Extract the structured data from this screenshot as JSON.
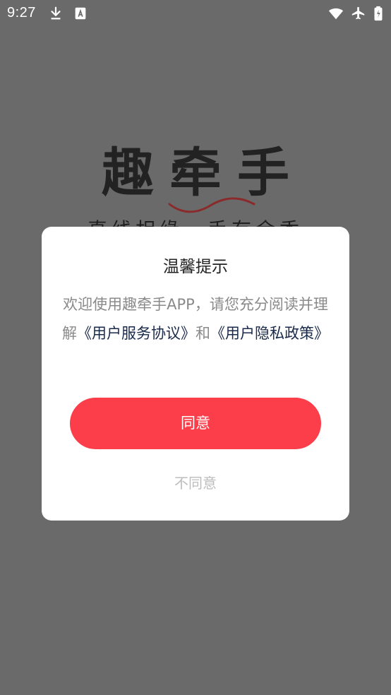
{
  "status_bar": {
    "time": "9:27",
    "icons": [
      "download-icon",
      "font-icon",
      "wifi-icon",
      "airplane-icon",
      "battery-icon"
    ]
  },
  "splash": {
    "logo_text": "趣牵手",
    "slogan": "真线相缘，手有余香",
    "wave_color": "#8b2a2a"
  },
  "dialog": {
    "title": "温馨提示",
    "body_intro": "欢迎使用趣牵手APP，请您充分阅读并理解",
    "link_service": "《用户服务协议》",
    "body_and": "和",
    "link_privacy": "《用户隐私政策》",
    "agree_label": "同意",
    "disagree_label": "不同意"
  },
  "colors": {
    "accent": "#fb3e4a",
    "link": "#1a2a4a",
    "background_dim": "#6a6a6a"
  }
}
